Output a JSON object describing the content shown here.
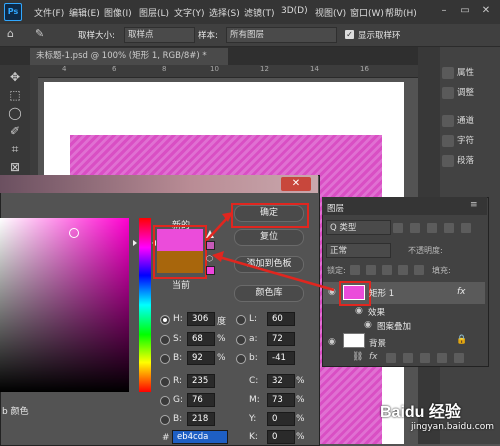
{
  "app": {
    "logo": "Ps"
  },
  "menu": [
    "文件(F)",
    "编辑(E)",
    "图像(I)",
    "图层(L)",
    "文字(Y)",
    "选择(S)",
    "滤镜(T)",
    "3D(D)",
    "视图(V)",
    "窗口(W)",
    "帮助(H)"
  ],
  "options": {
    "sample_size_label": "取样大小:",
    "sample_size_value": "取样点",
    "sample_label": "样本:",
    "sample_value": "所有图层",
    "show_ring_label": "显示取样环"
  },
  "document_tab": "未标题-1.psd @ 100% (矩形 1, RGB/8#) *",
  "ruler_marks": [
    "4",
    "6",
    "8",
    "10",
    "12",
    "14",
    "16"
  ],
  "right_panel": [
    "属性",
    "调整",
    "通道",
    "字符",
    "段落"
  ],
  "picker": {
    "new_label": "新的",
    "current_label": "当前",
    "ok_label": "确定",
    "reset_label": "复位",
    "add_swatch_label": "添加到色板",
    "libraries_label": "颜色库",
    "only_web_colors_label": "b 颜色",
    "new_color": "#eb4cda",
    "current_color": "#a8660c",
    "fields": {
      "H": {
        "label": "H:",
        "value": "306",
        "unit": "度"
      },
      "S": {
        "label": "S:",
        "value": "68",
        "unit": "%"
      },
      "B": {
        "label": "B:",
        "value": "92",
        "unit": "%"
      },
      "R": {
        "label": "R:",
        "value": "235"
      },
      "G": {
        "label": "G:",
        "value": "76"
      },
      "Bb": {
        "label": "B:",
        "value": "218"
      },
      "L": {
        "label": "L:",
        "value": "60"
      },
      "a": {
        "label": "a:",
        "value": "72"
      },
      "b": {
        "label": "b:",
        "value": "-41"
      },
      "C": {
        "label": "C:",
        "value": "32",
        "unit": "%"
      },
      "M": {
        "label": "M:",
        "value": "73",
        "unit": "%"
      },
      "Y": {
        "label": "Y:",
        "value": "0",
        "unit": "%"
      },
      "K": {
        "label": "K:",
        "value": "0",
        "unit": "%"
      },
      "hex": {
        "label": "#",
        "value": "eb4cda"
      }
    }
  },
  "layers": {
    "title": "图层",
    "kind_label": "Q 类型",
    "blend_mode": "正常",
    "opacity_label": "不透明度:",
    "lock_label": "锁定:",
    "fill_label": "填充:",
    "items": [
      {
        "name": "矩形 1",
        "fx": "fx"
      },
      {
        "name": "效果"
      },
      {
        "name": "图案叠加"
      },
      {
        "name": "背景"
      }
    ]
  },
  "watermark": {
    "brand": "Baidu 经验",
    "url": "jingyan.baidu.com"
  }
}
